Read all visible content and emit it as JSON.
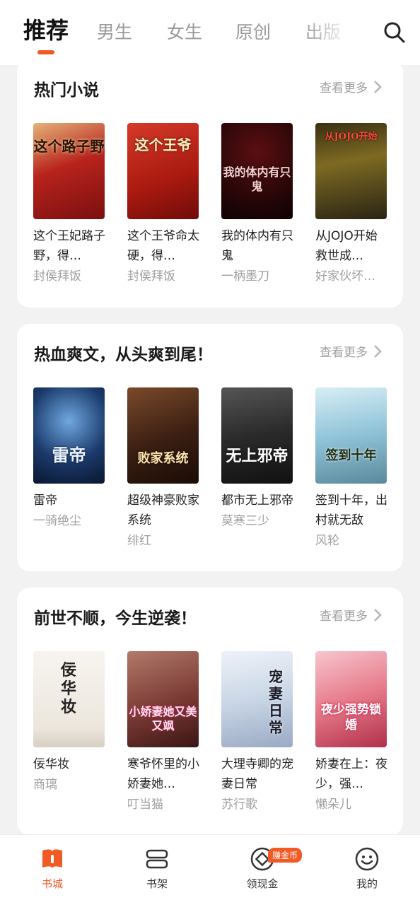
{
  "tabs": [
    {
      "label": "推荐"
    },
    {
      "label": "男生"
    },
    {
      "label": "女生"
    },
    {
      "label": "原创"
    },
    {
      "label": "出版"
    }
  ],
  "accent": "#f15a24",
  "more_label": "查看更多",
  "sections": [
    {
      "title": "热门小说",
      "books": [
        {
          "name": "这个王妃路子野，得…",
          "author": "封侯拜饭",
          "cover_text": "这个路子野",
          "cover_bg": "#b8231c"
        },
        {
          "name": "这个王爷命太硬，得…",
          "author": "封侯拜饭",
          "cover_text": "这个王爷",
          "cover_bg": "#c0271f"
        },
        {
          "name": "我的体内有只鬼",
          "author": "一柄墨刀",
          "cover_text": "我的体内有只鬼",
          "cover_bg": "#4a0d0d"
        },
        {
          "name": "从JOJO开始救世成…",
          "author": "好家伙坏…",
          "cover_text": "从JOJO开始",
          "cover_bg": "#6b5a1d"
        }
      ]
    },
    {
      "title": "热血爽文，从头爽到尾！",
      "books": [
        {
          "name": "雷帝",
          "author": "一骑绝尘",
          "cover_text": "雷帝",
          "cover_bg": "#1b3a6b"
        },
        {
          "name": "超级神豪败家系统",
          "author": "绯红",
          "cover_text": "败家系统",
          "cover_bg": "#3a1e12"
        },
        {
          "name": "都市无上邪帝",
          "author": "莫寒三少",
          "cover_text": "无上邪帝",
          "cover_bg": "#2a2a2a"
        },
        {
          "name": "签到十年，出村就无敌",
          "author": "风轮",
          "cover_text": "签到十年",
          "cover_bg": "#8fc3d8"
        }
      ]
    },
    {
      "title": "前世不顺，今生逆袭！",
      "books": [
        {
          "name": "佞华妆",
          "author": "商璃",
          "cover_text": "佞华妆",
          "cover_bg": "#f2eee9"
        },
        {
          "name": "寒爷怀里的小娇妻她…",
          "author": "叮当猫",
          "cover_text": "小娇妻她又美又飒",
          "cover_bg": "#7a3a34"
        },
        {
          "name": "大理寺卿的宠妻日常",
          "author": "苏行歌",
          "cover_text": "宠妻日常",
          "cover_bg": "#c9d6e6"
        },
        {
          "name": "娇妻在上：夜少，强…",
          "author": "懒朵儿",
          "cover_text": "夜少强势锁婚",
          "cover_bg": "#e67a8a"
        }
      ]
    }
  ],
  "bottom_nav": [
    {
      "label": "书城",
      "icon": "book-icon",
      "active": true
    },
    {
      "label": "书架",
      "icon": "shelf-icon",
      "active": false
    },
    {
      "label": "领现金",
      "icon": "coin-icon",
      "active": false,
      "badge": "赚金币"
    },
    {
      "label": "我的",
      "icon": "smile-icon",
      "active": false
    }
  ]
}
